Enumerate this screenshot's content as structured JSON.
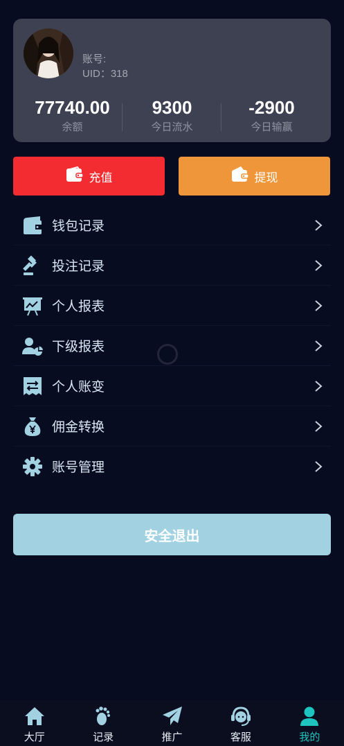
{
  "profile": {
    "account_label": "账号:",
    "uid_label": "UID：318",
    "stats": [
      {
        "value": "77740.00",
        "label": "余额"
      },
      {
        "value": "9300",
        "label": "今日流水"
      },
      {
        "value": "-2900",
        "label": "今日输赢"
      }
    ]
  },
  "actions": {
    "recharge_label": "充值",
    "withdraw_label": "提现"
  },
  "menu": [
    {
      "label": "钱包记录",
      "icon": "wallet-icon"
    },
    {
      "label": "投注记录",
      "icon": "gavel-icon"
    },
    {
      "label": "个人报表",
      "icon": "chart-board-icon"
    },
    {
      "label": "下级报表",
      "icon": "user-pie-icon"
    },
    {
      "label": "个人账变",
      "icon": "exchange-receipt-icon"
    },
    {
      "label": "佣金转换",
      "icon": "money-bag-icon"
    },
    {
      "label": "账号管理",
      "icon": "gear-icon"
    }
  ],
  "logout_label": "安全退出",
  "tabs": [
    {
      "label": "大厅",
      "icon": "home-icon"
    },
    {
      "label": "记录",
      "icon": "footprint-icon"
    },
    {
      "label": "推广",
      "icon": "paper-plane-icon"
    },
    {
      "label": "客服",
      "icon": "headset-icon"
    },
    {
      "label": "我的",
      "icon": "user-icon",
      "active": true
    }
  ],
  "colors": {
    "background": "#080c20",
    "card": "#3d4152",
    "recharge": "#f22c31",
    "withdraw": "#ee9639",
    "logout": "#a2d2e2",
    "menu_icon": "#a2d2e2",
    "tab_active": "#1ec5c0"
  }
}
